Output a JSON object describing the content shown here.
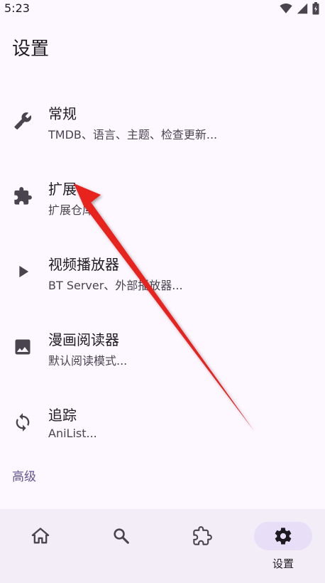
{
  "status_bar": {
    "time": "5:23",
    "icons": [
      "wifi-icon",
      "signal-icon",
      "battery-icon"
    ]
  },
  "page": {
    "title": "设置"
  },
  "settings": {
    "items": [
      {
        "title": "常规",
        "subtitle": "TMDB、语言、主题、检查更新...",
        "icon": "tools-icon"
      },
      {
        "title": "扩展",
        "subtitle": "扩展仓库",
        "icon": "puzzle-icon"
      },
      {
        "title": "视频播放器",
        "subtitle": "BT Server、外部播放器...",
        "icon": "play-icon"
      },
      {
        "title": "漫画阅读器",
        "subtitle": "默认阅读模式...",
        "icon": "image-icon"
      },
      {
        "title": "追踪",
        "subtitle": "AniList...",
        "icon": "sync-icon"
      }
    ],
    "section_header": "高级"
  },
  "bottom_nav": {
    "items": [
      {
        "icon": "home-icon",
        "label": ""
      },
      {
        "icon": "search-icon",
        "label": ""
      },
      {
        "icon": "extension-icon",
        "label": ""
      },
      {
        "icon": "gear-icon",
        "label": "设置",
        "active": true
      }
    ]
  },
  "colors": {
    "background": "#fdf7ff",
    "nav_background": "#f2edf6",
    "active_pill": "#e8def8",
    "accent": "#65558f",
    "annotation_arrow": "#e8221f"
  }
}
